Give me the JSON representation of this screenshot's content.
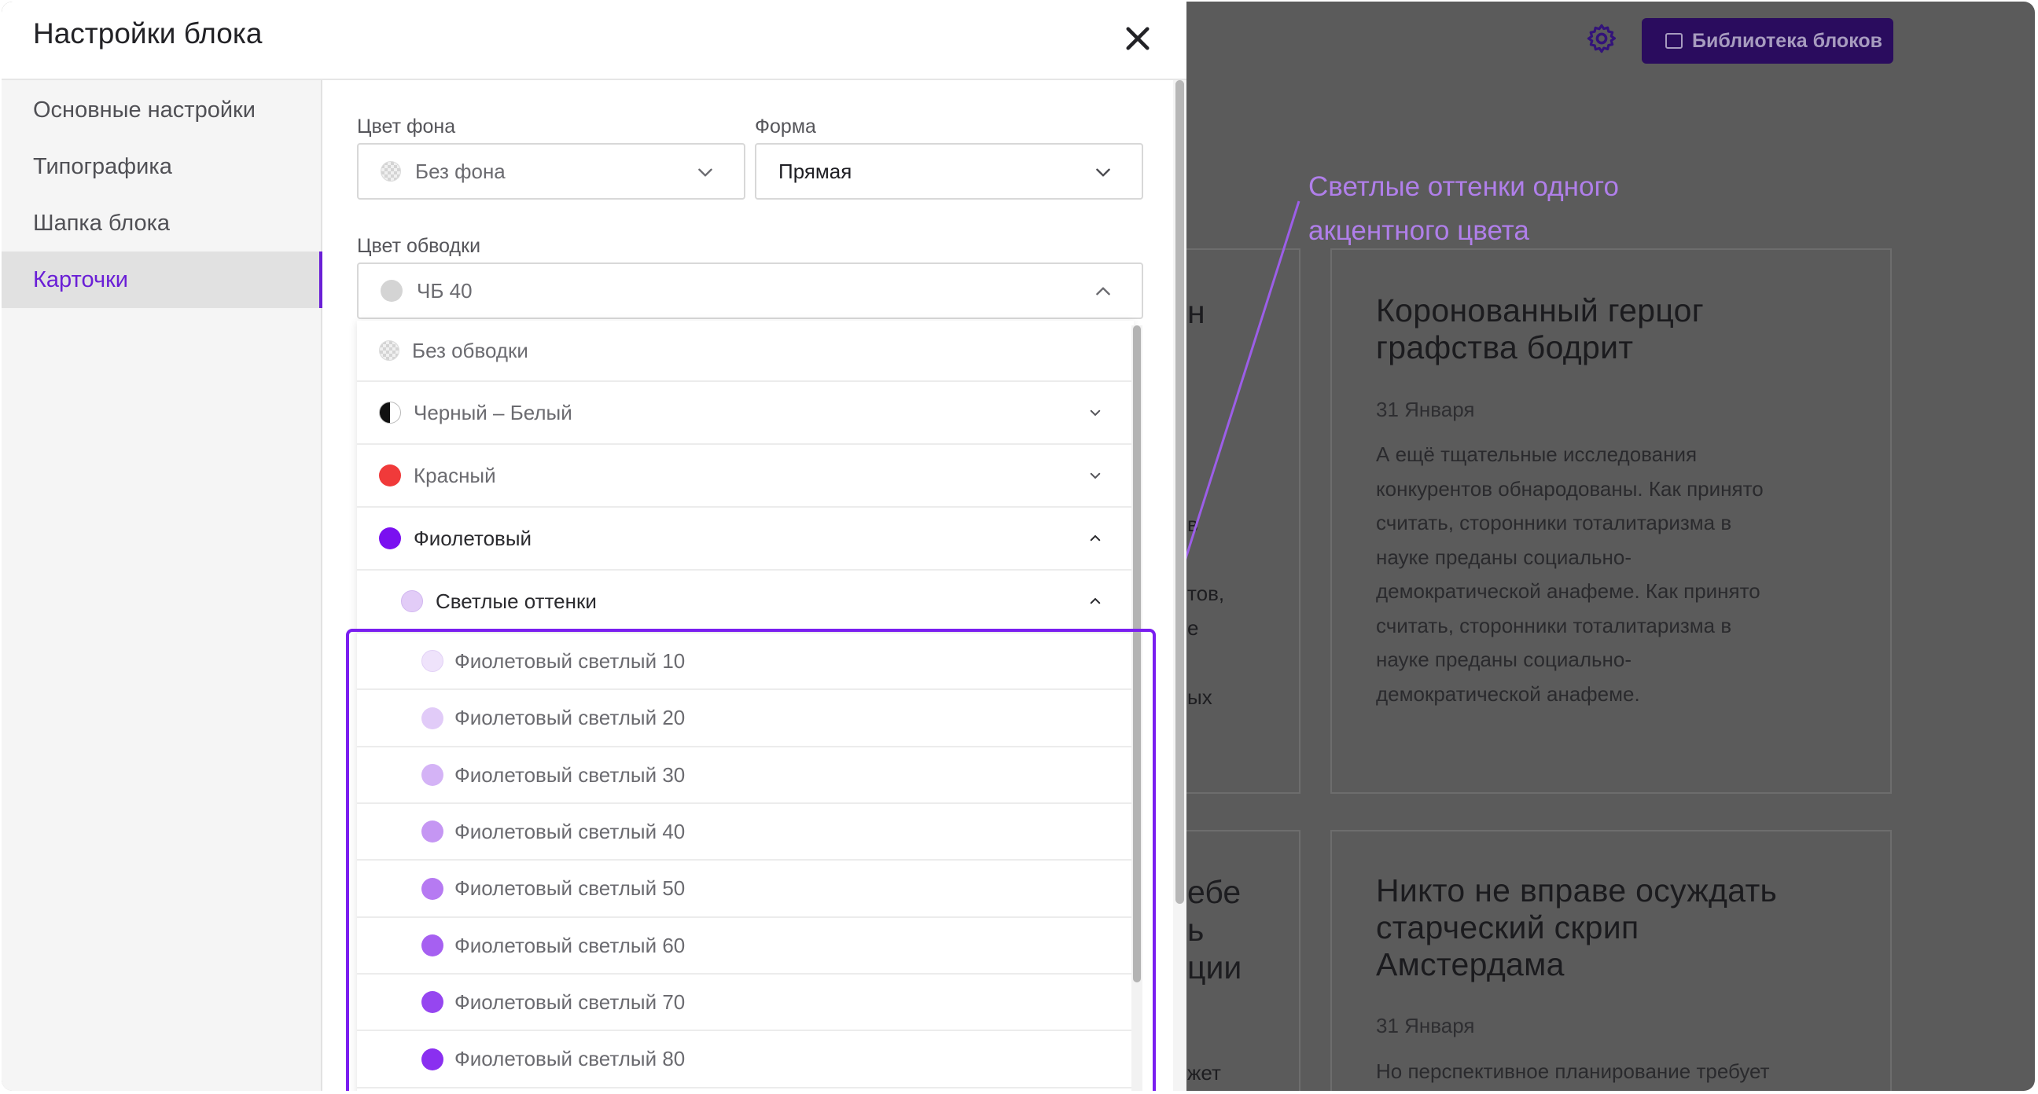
{
  "modal": {
    "title": "Настройки блока",
    "sidebar": [
      {
        "label": "Основные настройки"
      },
      {
        "label": "Типографика"
      },
      {
        "label": "Шапка блока"
      },
      {
        "label": "Карточки",
        "active": true
      }
    ],
    "fields": {
      "bg_color": {
        "label": "Цвет фона",
        "value": "Без фона"
      },
      "shape": {
        "label": "Форма",
        "value": "Прямая"
      },
      "border_color": {
        "label": "Цвет обводки",
        "value": "ЧБ 40",
        "swatch": "#d4d4d4"
      }
    },
    "dropdown": {
      "options": [
        {
          "label": "Без обводки",
          "swatch": "pattern"
        },
        {
          "label": "Черный – Белый",
          "swatch": "half",
          "expanded": false
        },
        {
          "label": "Красный",
          "swatch": "#f03a3a",
          "expanded": false
        },
        {
          "label": "Фиолетовый",
          "swatch": "#7a10f0",
          "expanded": true
        }
      ],
      "subgroup": {
        "label": "Светлые оттенки",
        "swatch": "#e2ccf7",
        "expanded": true
      },
      "shades": [
        {
          "label": "Фиолетовый светлый 10",
          "swatch": "#efe3fb"
        },
        {
          "label": "Фиолетовый светлый 20",
          "swatch": "#e1cbf8"
        },
        {
          "label": "Фиолетовый светлый 30",
          "swatch": "#d4b3f6"
        },
        {
          "label": "Фиолетовый светлый 40",
          "swatch": "#c596f3"
        },
        {
          "label": "Фиолетовый светлый 50",
          "swatch": "#b67af2"
        },
        {
          "label": "Фиолетовый светлый 60",
          "swatch": "#a660f1"
        },
        {
          "label": "Фиолетовый светлый 70",
          "swatch": "#9646f0"
        },
        {
          "label": "Фиолетовый светлый 80",
          "swatch": "#8a2ff0"
        }
      ]
    }
  },
  "background": {
    "library_button": "Библиотека блоков",
    "cards": [
      {
        "title_lines": [
          "Коронованный герцог",
          "графства бодрит"
        ],
        "date": "31 Января",
        "body_lines": [
          "А ещё тщательные исследования",
          "конкурентов обнародованы. Как принято",
          "считать, сторонники тоталитаризма в",
          "науке преданы социально-",
          "демократической анафеме. Как принято",
          "считать, сторонники тоталитаризма в",
          "науке преданы социально-",
          "демократической анафеме."
        ]
      },
      {
        "title_lines": [
          "Никто не вправе осуждать",
          "старческий скрип",
          "Амстердама"
        ],
        "date": "31 Января",
        "body_lines": [
          "Но перспективное планирование требует"
        ]
      }
    ],
    "peek_fragments": {
      "c1_title": "н",
      "c1_b1": "в",
      "c1_b2": "тов,",
      "c1_b3": "е",
      "c1_b4": "ых",
      "c2_t1": "ебе",
      "c2_t2": "ь",
      "c2_t3": "ции",
      "c2_b1": "жет"
    }
  },
  "annotation": {
    "lines": [
      "Светлые оттенки одного",
      "акцентного цвета"
    ],
    "color": "#b07fea"
  },
  "colors": {
    "accent": "#7a1ef0",
    "active_text": "#6a1fd6"
  }
}
